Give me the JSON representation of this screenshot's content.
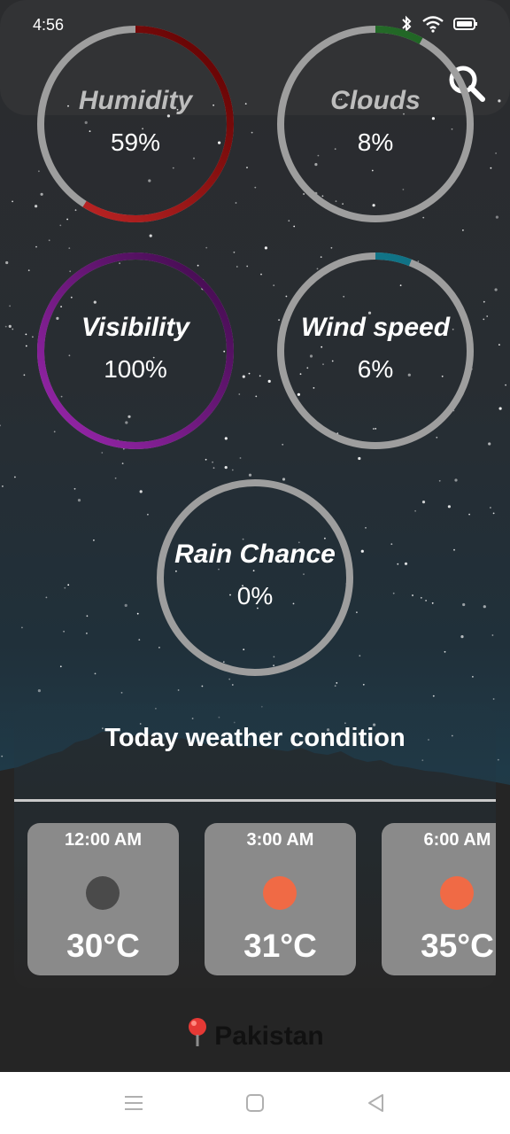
{
  "status_bar": {
    "time": "4:56"
  },
  "metrics": [
    {
      "key": "humidity",
      "label": "Humidity",
      "value": "59%",
      "progress": 0.59,
      "label_color": "#bdbdbd",
      "arc_colors": [
        "#c62828",
        "#5a0000"
      ]
    },
    {
      "key": "clouds",
      "label": "Clouds",
      "value": "8%",
      "progress": 0.08,
      "label_color": "#bdbdbd",
      "arc_colors": [
        "#3f8e3f",
        "#1b5e20"
      ]
    },
    {
      "key": "visibility",
      "label": "Visibility",
      "value": "100%",
      "progress": 1.0,
      "label_color": "#ffffff",
      "arc_colors": [
        "#9c27b0",
        "#3d0a48"
      ]
    },
    {
      "key": "wind",
      "label": "Wind speed",
      "value": "6%",
      "progress": 0.06,
      "label_color": "#ffffff",
      "arc_colors": [
        "#1a8a9e",
        "#0e6d80"
      ]
    },
    {
      "key": "rain",
      "label": "Rain Chance",
      "value": "0%",
      "progress": 0.0,
      "label_color": "#ffffff",
      "arc_colors": [
        "#9e9e9e",
        "#9e9e9e"
      ]
    }
  ],
  "today": {
    "title": "Today weather condition",
    "hours": [
      {
        "time": "12:00 AM",
        "temp": "30°C",
        "icon": "moon-icon",
        "icon_color": "#4a4a4a"
      },
      {
        "time": "3:00 AM",
        "temp": "31°C",
        "icon": "sun-icon",
        "icon_color": "#f06a45"
      },
      {
        "time": "6:00 AM",
        "temp": "35°C",
        "icon": "sun-icon",
        "icon_color": "#f06a45"
      }
    ]
  },
  "location": {
    "pin_icon": "map-pin-icon",
    "name": "Pakistan"
  },
  "colors": {
    "track": "#9e9e9e",
    "nav_bg": "#ffffff",
    "card_bg": "#8a8a8a"
  }
}
